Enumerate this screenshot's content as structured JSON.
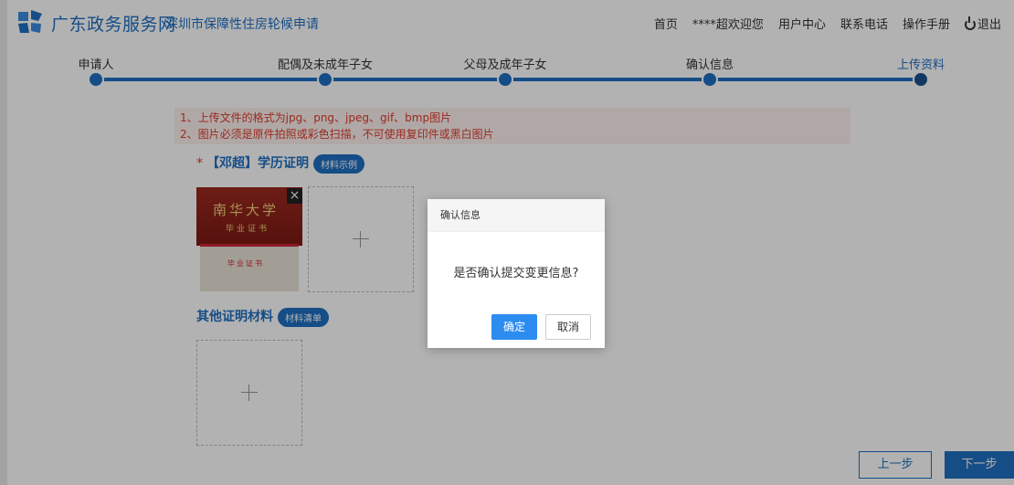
{
  "header": {
    "brand": "广东政务服务网",
    "subtitle": "深圳市保障性住房轮候申请",
    "nav": {
      "home": "首页",
      "welcome": "****超欢迎您",
      "user_center": "用户中心",
      "contact": "联系电话",
      "manual": "操作手册",
      "logout": "退出"
    },
    "logo_icon": "gd-gov-logo-icon"
  },
  "steps": [
    {
      "label": "申请人",
      "state": "done"
    },
    {
      "label": "配偶及未成年子女",
      "state": "done"
    },
    {
      "label": "父母及成年子女",
      "state": "done"
    },
    {
      "label": "确认信息",
      "state": "done"
    },
    {
      "label": "上传资料",
      "state": "active"
    }
  ],
  "notice": {
    "line1": "1、上传文件的格式为jpg、png、jpeg、gif、bmp图片",
    "line2": "2、图片必须是原件拍照或彩色扫描，不可使用复印件或黑白图片"
  },
  "sections": {
    "education": {
      "required_mark": "*",
      "title": "【邓超】学历证明",
      "pill": "材料示例"
    },
    "other": {
      "title": "其他证明材料",
      "pill": "材料清单"
    }
  },
  "thumbnail": {
    "text1": "南华大学",
    "text2": "毕业证书",
    "text3": "毕业证书"
  },
  "buttons": {
    "prev": "上一步",
    "next": "下一步"
  },
  "dialog": {
    "title": "确认信息",
    "message": "是否确认提交变更信息?",
    "ok": "确定",
    "cancel": "取消"
  },
  "colors": {
    "primary": "#1f6fc2",
    "dialog_ok": "#2d8cf0",
    "notice_text": "#e03a2c",
    "notice_bg": "#fdf1ee"
  }
}
